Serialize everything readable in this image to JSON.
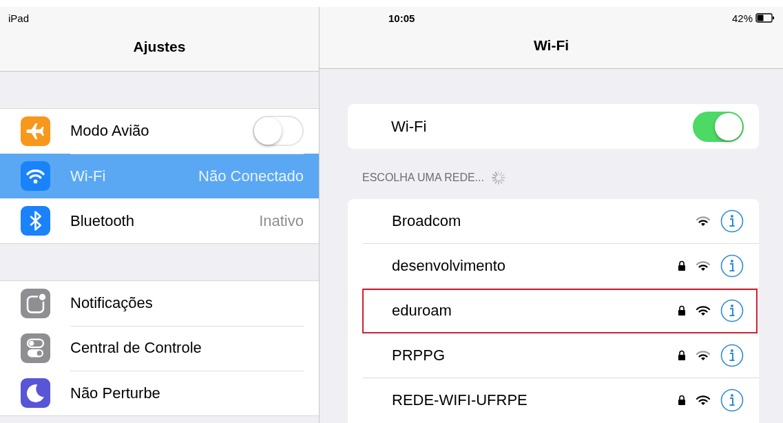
{
  "status_bar": {
    "device": "iPad",
    "time": "10:05",
    "battery": "42%"
  },
  "sidebar": {
    "title": "Ajustes",
    "groups": [
      {
        "items": [
          {
            "kind": "toggle",
            "label": "Modo Avião",
            "color": "#f7981c",
            "on": false,
            "selected": false
          },
          {
            "kind": "value",
            "label": "Wi-Fi",
            "value": "Não Conectado",
            "color": "#1a82fb",
            "selected": true
          },
          {
            "kind": "value",
            "label": "Bluetooth",
            "value": "Inativo",
            "color": "#1a82fb",
            "selected": false
          }
        ]
      },
      {
        "items": [
          {
            "kind": "plain",
            "label": "Notificações",
            "color": "#8e8e93",
            "selected": false
          },
          {
            "kind": "plain",
            "label": "Central de Controle",
            "color": "#8e8e93",
            "selected": false
          },
          {
            "kind": "plain",
            "label": "Não Perturbe",
            "color": "#5856d6",
            "selected": false
          }
        ]
      }
    ]
  },
  "detail": {
    "title": "Wi-Fi",
    "wifi_toggle": {
      "label": "Wi-Fi",
      "on": true
    },
    "section_header": "ESCOLHA UMA REDE...",
    "networks": [
      {
        "name": "Broadcom",
        "locked": false,
        "highlighted": false
      },
      {
        "name": "desenvolvimento",
        "locked": true,
        "highlighted": false
      },
      {
        "name": "eduroam",
        "locked": true,
        "highlighted": true
      },
      {
        "name": "PRPPG",
        "locked": true,
        "highlighted": false
      },
      {
        "name": "REDE-WIFI-UFRPE",
        "locked": true,
        "highlighted": false
      }
    ]
  }
}
